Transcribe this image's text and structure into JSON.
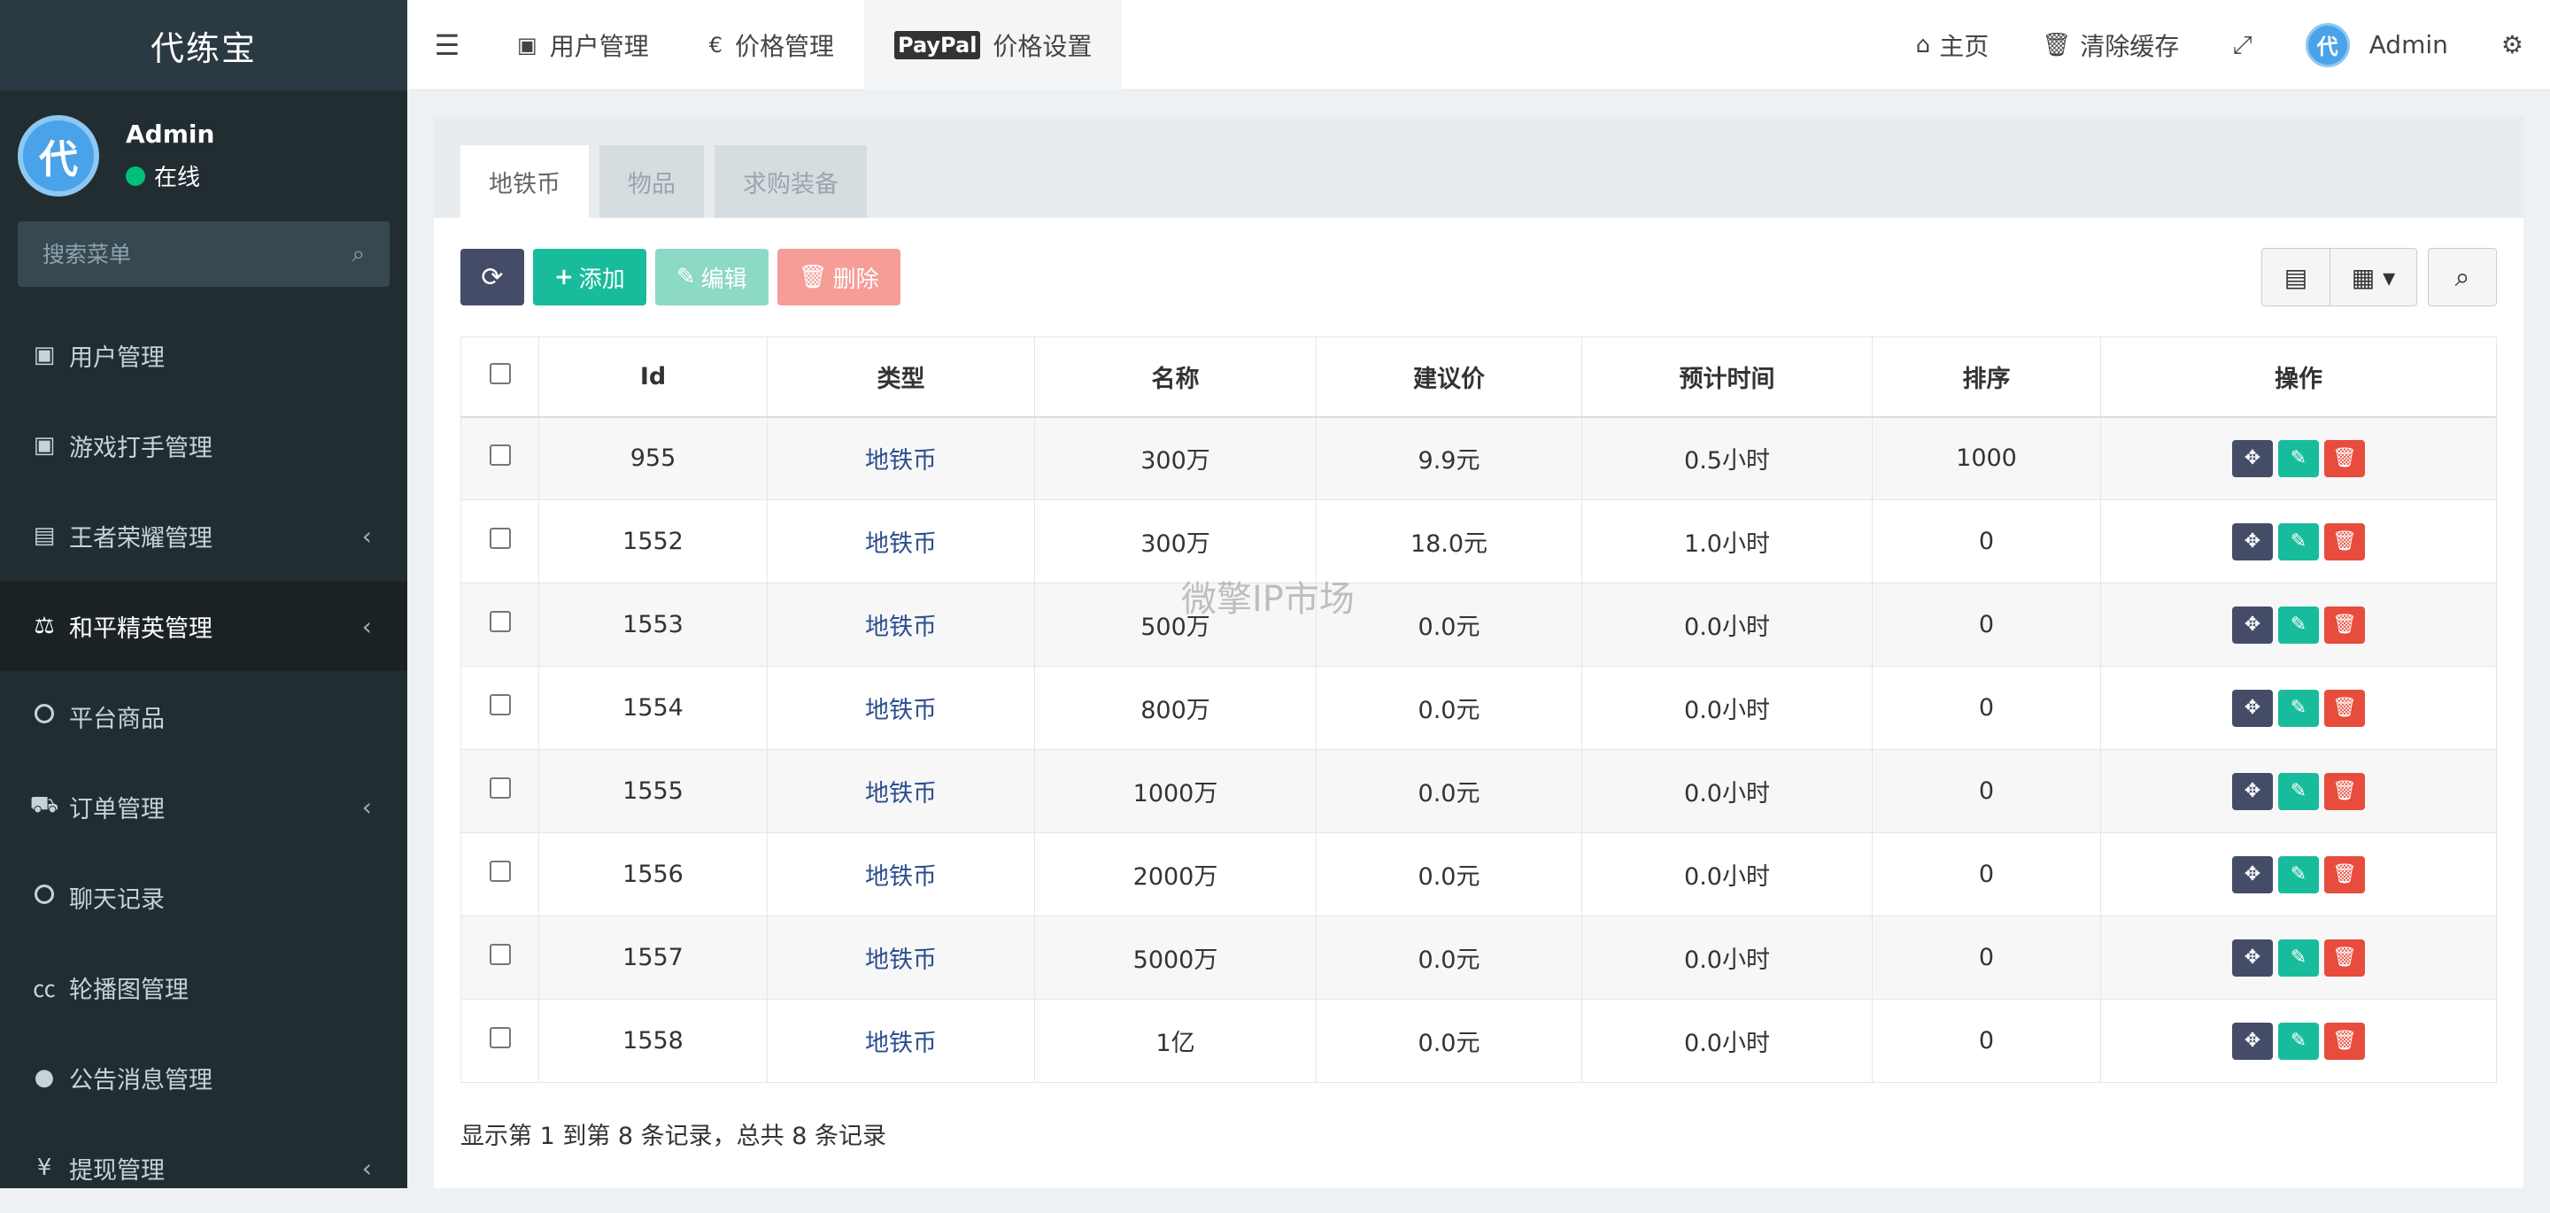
{
  "sidebar": {
    "brand": "代练宝",
    "user": {
      "avatar_char": "代",
      "name": "Admin",
      "status": "在线"
    },
    "search_placeholder": "搜索菜单",
    "items": [
      {
        "label": "用户管理",
        "icon": "address-book-icon",
        "glyph": "▣",
        "chevron": ""
      },
      {
        "label": "游戏打手管理",
        "icon": "address-book-icon",
        "glyph": "▣",
        "chevron": ""
      },
      {
        "label": "王者荣耀管理",
        "icon": "id-card-icon",
        "glyph": "▤",
        "chevron": "‹"
      },
      {
        "label": "和平精英管理",
        "icon": "balance-scale-icon",
        "glyph": "⚖",
        "chevron": "‹"
      },
      {
        "label": "平台商品",
        "icon": "circle-icon",
        "glyph": "",
        "chevron": ""
      },
      {
        "label": "订单管理",
        "icon": "cart-icon",
        "glyph": "⛟",
        "chevron": "‹"
      },
      {
        "label": "聊天记录",
        "icon": "circle-icon",
        "glyph": "",
        "chevron": ""
      },
      {
        "label": "轮播图管理",
        "icon": "cc-icon",
        "glyph": "㏄",
        "chevron": ""
      },
      {
        "label": "公告消息管理",
        "icon": "comment-icon",
        "glyph": "●",
        "chevron": ""
      },
      {
        "label": "提现管理",
        "icon": "yen-icon",
        "glyph": "¥",
        "chevron": "‹"
      }
    ]
  },
  "topnav": {
    "tabs": [
      {
        "label": "用户管理",
        "icon": "address-book-icon",
        "glyph": "▣"
      },
      {
        "label": "价格管理",
        "icon": "euro-icon",
        "glyph": "€"
      },
      {
        "label": "价格设置",
        "icon": "paypal-icon",
        "glyph": "PayPal"
      }
    ],
    "home": "主页",
    "clear_cache": "清除缓存",
    "admin_avatar_char": "代",
    "admin": "Admin"
  },
  "content_tabs": [
    "地铁币",
    "物品",
    "求购装备"
  ],
  "toolbar": {
    "add": "添加",
    "edit": "编辑",
    "delete": "删除"
  },
  "table": {
    "headers": [
      "Id",
      "类型",
      "名称",
      "建议价",
      "预计时间",
      "排序",
      "操作"
    ],
    "rows": [
      {
        "id": "955",
        "type": "地铁币",
        "name": "300万",
        "price": "9.9元",
        "time": "0.5小时",
        "sort": "1000"
      },
      {
        "id": "1552",
        "type": "地铁币",
        "name": "300万",
        "price": "18.0元",
        "time": "1.0小时",
        "sort": "0"
      },
      {
        "id": "1553",
        "type": "地铁币",
        "name": "500万",
        "price": "0.0元",
        "time": "0.0小时",
        "sort": "0"
      },
      {
        "id": "1554",
        "type": "地铁币",
        "name": "800万",
        "price": "0.0元",
        "time": "0.0小时",
        "sort": "0"
      },
      {
        "id": "1555",
        "type": "地铁币",
        "name": "1000万",
        "price": "0.0元",
        "time": "0.0小时",
        "sort": "0"
      },
      {
        "id": "1556",
        "type": "地铁币",
        "name": "2000万",
        "price": "0.0元",
        "time": "0.0小时",
        "sort": "0"
      },
      {
        "id": "1557",
        "type": "地铁币",
        "name": "5000万",
        "price": "0.0元",
        "time": "0.0小时",
        "sort": "0"
      },
      {
        "id": "1558",
        "type": "地铁币",
        "name": "1亿",
        "price": "0.0元",
        "time": "0.0小时",
        "sort": "0"
      }
    ]
  },
  "footer": "显示第 1 到第 8 条记录，总共 8 条记录",
  "watermark": "微擎IP市场"
}
